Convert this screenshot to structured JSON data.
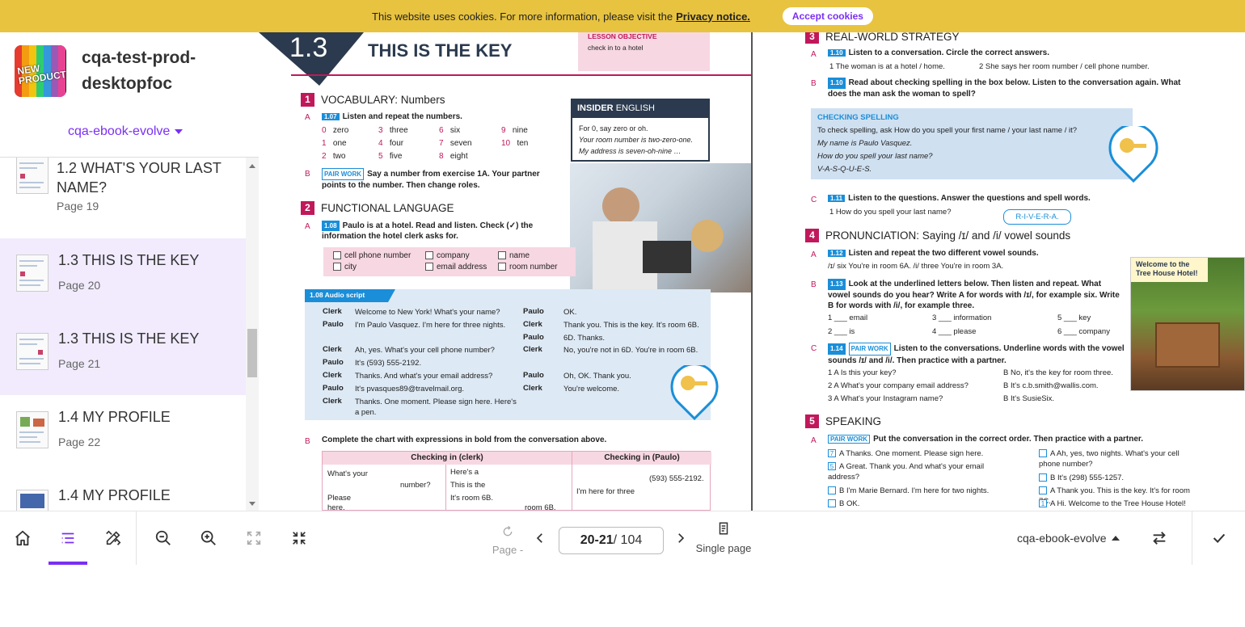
{
  "cookie": {
    "message": "This website uses cookies. For more information, please visit the",
    "link": "Privacy notice.",
    "accept": "Accept cookies"
  },
  "sidebar": {
    "logo_text": "NEW PRODUCT",
    "title": "cqa-test-prod-desktopfoc",
    "book": "cqa-ebook-evolve",
    "items": [
      {
        "title": "1.2 WHAT'S YOUR LAST NAME?",
        "page": "Page 19",
        "active": false
      },
      {
        "title": "1.3 THIS IS THE KEY",
        "page": "Page 20",
        "active": true
      },
      {
        "title": "1.3 THIS IS THE KEY",
        "page": "Page 21",
        "active": true
      },
      {
        "title": "1.4 MY PROFILE",
        "page": "Page 22",
        "active": false
      },
      {
        "title": "1.4 MY PROFILE",
        "page": "",
        "active": false
      }
    ]
  },
  "book": {
    "left": {
      "unit": "1.3",
      "heading": "THIS IS THE KEY",
      "objective_label": "LESSON OBJECTIVE",
      "objective": "check in to a hotel",
      "s1_num": "1",
      "s1_title": "VOCABULARY: Numbers",
      "s1a": "Listen and repeat the numbers.",
      "s1a_audio": "1.07",
      "numbers": [
        [
          "0",
          "zero"
        ],
        [
          "1",
          "one"
        ],
        [
          "2",
          "two"
        ],
        [
          "3",
          "three"
        ],
        [
          "4",
          "four"
        ],
        [
          "5",
          "five"
        ],
        [
          "6",
          "six"
        ],
        [
          "7",
          "seven"
        ],
        [
          "8",
          "eight"
        ],
        [
          "9",
          "nine"
        ],
        [
          "10",
          "ten"
        ]
      ],
      "s1b": "Say a number from exercise 1A. Your partner points to the number. Then change roles.",
      "pair_work": "PAIR WORK",
      "insider_title": "INSIDER",
      "insider_title2": "ENGLISH",
      "insider_l1": "For 0, say zero or oh.",
      "insider_l2": "Your room number is two-zero-one.",
      "insider_l3": "My address is seven-oh-nine …",
      "s2_num": "2",
      "s2_title": "FUNCTIONAL LANGUAGE",
      "s2a_audio": "1.08",
      "s2a": "Paulo is at a hotel. Read and listen. Check (✓) the information the hotel clerk asks for.",
      "checks": [
        "cell phone number",
        "city",
        "company",
        "email address",
        "name",
        "room number"
      ],
      "script_title": "1.08 Audio script",
      "script_left": [
        [
          "Clerk",
          "Welcome to New York! What's your name?"
        ],
        [
          "Paulo",
          "I'm Paulo Vasquez. I'm here for three nights."
        ],
        [
          "Clerk",
          "Ah, yes. What's your cell phone number?"
        ],
        [
          "Paulo",
          "It's (593) 555-2192."
        ],
        [
          "Clerk",
          "Thanks. And what's your email address?"
        ],
        [
          "Paulo",
          "It's pvasques89@travelmail.org."
        ],
        [
          "Clerk",
          "Thanks. One moment. Please sign here. Here's a pen."
        ]
      ],
      "script_right": [
        [
          "Paulo",
          "OK."
        ],
        [
          "Clerk",
          "Thank you. This is the key. It's room 6B."
        ],
        [
          "Paulo",
          "6D. Thanks."
        ],
        [
          "Clerk",
          "No, you're not in 6D. You're in room 6B."
        ],
        [
          "Paulo",
          "Oh, OK. Thank you."
        ],
        [
          "Clerk",
          "You're welcome."
        ]
      ],
      "s2b": "Complete the chart with expressions in bold from the conversation above.",
      "chart_h1": "Checking in (clerk)",
      "chart_h2": "Checking in (Paulo)",
      "chart_c1": "What's your",
      "chart_c1b": "number?",
      "chart_c1c": "Please",
      "chart_c1d": "here.",
      "chart_c2": "Here's a",
      "chart_c2b": "This is the",
      "chart_c2c": "It's room 6B.",
      "chart_c2d": "room 6B.",
      "chart_c3": "(593) 555-2192.",
      "chart_c3b": "I'm here for three"
    },
    "right": {
      "s3_num": "3",
      "s3_title": "REAL-WORLD STRATEGY",
      "s3a_audio": "1.10",
      "s3a": "Listen to a conversation. Circle the correct answers.",
      "s3a1": "1  The woman is at a hotel / home.",
      "s3a2": "2  She says her room number / cell phone number.",
      "s3b_audio": "1.10",
      "s3b": "Read about checking spelling in the box below. Listen to the conversation again. What does the man ask the woman to spell?",
      "cs_title": "CHECKING SPELLING",
      "cs1": "To check spelling, ask How do you spell your first name / your last name / it?",
      "cs2": "My name is Paulo Vasquez.",
      "cs3": "How do you spell your last name?",
      "cs4": "V-A-S-Q-U-E-S.",
      "s3c_audio": "1.11",
      "s3c": "Listen to the questions. Answer the questions and spell words.",
      "s3c1": "1  How do you spell your last name?",
      "bubble": "R-I-V-E-R-A.",
      "s4_num": "4",
      "s4_title": "PRONUNCIATION: Saying /ɪ/ and /i/ vowel sounds",
      "s4a_audio": "1.12",
      "s4a": "Listen and repeat the two different vowel sounds.",
      "s4a1": "/ɪ/ six  You're in room 6A.     /i/ three  You're in room 3A.",
      "s4b_audio": "1.13",
      "s4b": "Look at the underlined letters below. Then listen and repeat. What vowel sounds do you hear? Write A for words with /ɪ/, for example six. Write B for words with /i/, for example three.",
      "words": [
        "1 ___ email",
        "3 ___ information",
        "5 ___ key",
        "2 ___ is",
        "4 ___ please",
        "6 ___ company"
      ],
      "s4c_audio": "1.14",
      "s4c": "Listen to the conversations. Underline words with the vowel sounds /ɪ/ and /i/. Then practice with a partner.",
      "conv": [
        [
          "1  A  Is this your key?",
          "B  No, it's the key for room three."
        ],
        [
          "2  A  What's your company email address?",
          "B  It's c.b.smith@wallis.com."
        ],
        [
          "3  A  What's your Instagram name?",
          "B  It's SusieSix."
        ]
      ],
      "photo_caption": "Welcome to the Tree House Hotel!",
      "s5_num": "5",
      "s5_title": "SPEAKING",
      "s5a": "Put the conversation in the correct order. Then practice with a partner.",
      "order_left": [
        [
          "7",
          "A  Thanks. One moment. Please sign here."
        ],
        [
          "5",
          "A  Great. Thank you. And what's your email address?"
        ],
        [
          "",
          "B  I'm Marie Bernard. I'm here for two nights."
        ],
        [
          "",
          "B  OK."
        ]
      ],
      "order_right": [
        [
          "",
          "A  Ah, yes, two nights. What's your cell phone number?"
        ],
        [
          "",
          "B  It's (298) 555-1257."
        ],
        [
          "",
          "A  Thank you. This is the key. It's for room 7C."
        ],
        [
          "1",
          "A  Hi. Welcome to the Tree House Hotel!"
        ]
      ]
    }
  },
  "toolbar": {
    "page_label": "Page -",
    "page_current": "20-21",
    "page_total": " / 104",
    "single_page": "Single page",
    "book": "cqa-ebook-evolve"
  },
  "colors": {
    "accent": "#7a2ff3",
    "cookie_bg": "#e8c33f",
    "magenta": "#c1185b",
    "blue": "#1a8ed8"
  }
}
